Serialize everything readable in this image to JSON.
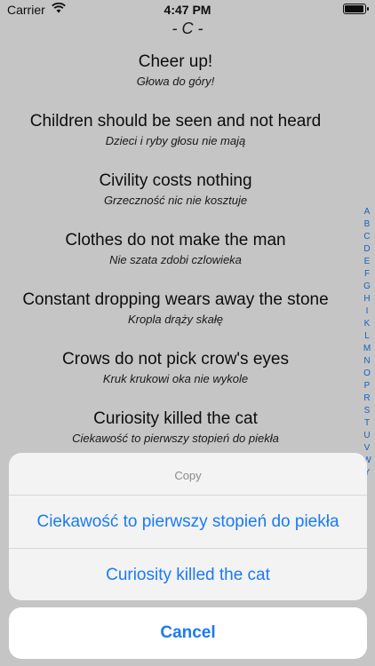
{
  "status_bar": {
    "carrier": "Carrier",
    "time": "4:47 PM"
  },
  "section_header": "- C -",
  "entries": [
    {
      "en": "Cheer up!",
      "pl": "Głowa do góry!"
    },
    {
      "en": "Children should be seen and not heard",
      "pl": "Dzieci i ryby głosu nie mają"
    },
    {
      "en": "Civility costs nothing",
      "pl": "Grzeczność nic nie kosztuje"
    },
    {
      "en": "Clothes do not make the man",
      "pl": "Nie szata zdobi czlowieka"
    },
    {
      "en": "Constant dropping wears away the stone",
      "pl": "Kropla drąży skałę"
    },
    {
      "en": "Crows do not pick crow's eyes",
      "pl": "Kruk krukowi oka nie wykole"
    },
    {
      "en": "Curiosity killed the cat",
      "pl": "Ciekawość to pierwszy stopień do piekła"
    }
  ],
  "index": [
    "A",
    "B",
    "C",
    "D",
    "E",
    "F",
    "G",
    "H",
    "I",
    "K",
    "L",
    "M",
    "N",
    "O",
    "P",
    "R",
    "S",
    "T",
    "U",
    "V",
    "W",
    "Y"
  ],
  "action_sheet": {
    "title": "Copy",
    "options": [
      "Ciekawość to pierwszy stopień do piekła",
      "Curiosity killed the cat"
    ],
    "cancel": "Cancel"
  },
  "colors": {
    "accent": "#1a7bf2",
    "dim_overlay": "rgba(0,0,0,0.2)"
  }
}
